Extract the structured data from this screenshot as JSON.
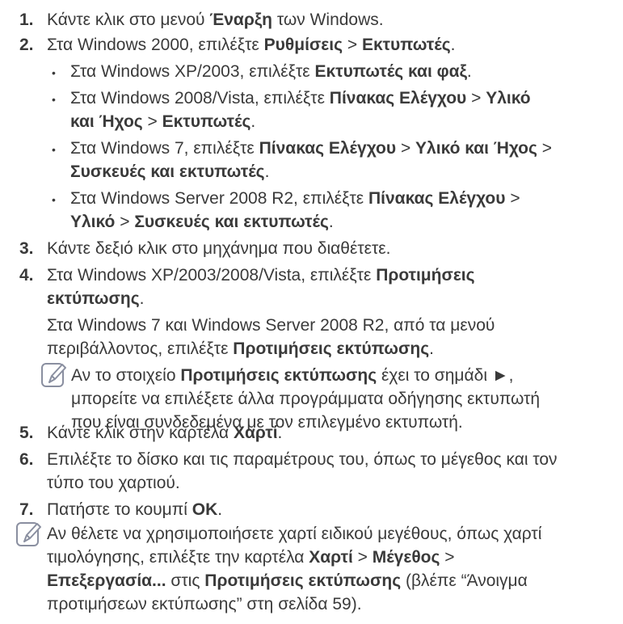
{
  "steps": [
    {
      "num": "1.",
      "text": [
        "Κάντε κλικ στο μενού ",
        {
          "b": "Έναρξη"
        },
        " των Windows."
      ]
    },
    {
      "num": "2.",
      "text": [
        "Στα Windows 2000, επιλέξτε ",
        {
          "b": "Ρυθμίσεις"
        },
        " > ",
        {
          "b": "Εκτυπωτές"
        },
        "."
      ]
    },
    {
      "bullet": "•",
      "text": [
        "Στα Windows XP/2003, επιλέξτε ",
        {
          "b": "Εκτυπωτές και φαξ"
        },
        "."
      ]
    },
    {
      "bullet": "•",
      "text": [
        "Στα Windows 2008/Vista, επιλέξτε ",
        {
          "b": "Πίνακας Ελέγχου"
        },
        " > ",
        {
          "b": "Υλικό"
        }
      ]
    },
    {
      "text": [
        {
          "b": "και Ήχος"
        },
        " > ",
        {
          "b": "Εκτυπωτές"
        },
        "."
      ]
    },
    {
      "bullet": "•",
      "text": [
        "Στα Windows 7, επιλέξτε ",
        {
          "b": "Πίνακας Ελέγχου"
        },
        " > ",
        {
          "b": "Υλικό και Ήχος"
        },
        " >"
      ]
    },
    {
      "text": [
        {
          "b": "Συσκευές και εκτυπωτές"
        },
        "."
      ]
    },
    {
      "bullet": "•",
      "text": [
        "Στα Windows Server 2008 R2, επιλέξτε ",
        {
          "b": "Πίνακας Ελέγχου"
        },
        " >"
      ]
    },
    {
      "text": [
        {
          "b": "Υλικό"
        },
        " > ",
        {
          "b": "Συσκευές και εκτυπωτές"
        },
        "."
      ]
    },
    {
      "num": "3.",
      "text": [
        "Κάντε δεξιό κλικ στο μηχάνημα που διαθέτετε."
      ]
    },
    {
      "num": "4.",
      "text": [
        "Στα Windows XP/2003/2008/Vista, επιλέξτε ",
        {
          "b": "Προτιμήσεις"
        }
      ]
    },
    {
      "text": [
        {
          "b": "εκτύπωσης"
        },
        "."
      ]
    },
    {
      "text": [
        "Στα Windows 7 και Windows Server 2008 R2, από τα μενού"
      ]
    },
    {
      "text": [
        "περιβάλλοντος, επιλέξτε ",
        {
          "b": "Προτιμήσεις εκτύπωσης"
        },
        "."
      ]
    },
    {
      "text": [
        "Αν το στοιχείο ",
        {
          "b": "Προτιμήσεις εκτύπωσης"
        },
        " έχει το σημάδι ►,"
      ]
    },
    {
      "text": [
        "μπορείτε να επιλέξετε άλλα προγράμματα οδήγησης εκτυπωτή"
      ]
    },
    {
      "text": [
        "που είναι συνδεδεμένα με τον επιλεγμένο εκτυπωτή."
      ]
    },
    {
      "num": "5.",
      "text": [
        "Κάντε κλικ στην καρτέλα ",
        {
          "b": "Χαρτί"
        },
        "."
      ]
    },
    {
      "num": "6.",
      "text": [
        "Επιλέξτε το δίσκο και τις παραμέτρους του, όπως το μέγεθος και τον"
      ]
    },
    {
      "text": [
        "τύπο του χαρτιού."
      ]
    },
    {
      "num": "7.",
      "text": [
        "Πατήστε το κουμπί ",
        {
          "b": "OK"
        },
        "."
      ]
    },
    {
      "text": [
        "Αν θέλετε να χρησιμοποιήσετε χαρτί ειδικού μεγέθους, όπως χαρτί"
      ]
    },
    {
      "text": [
        "τιμολόγησης, επιλέξτε την καρτέλα ",
        {
          "b": "Χαρτί"
        },
        " > ",
        {
          "b": "Μέγεθος"
        },
        " >"
      ]
    },
    {
      "text": [
        {
          "b": "Επεξεργασία..."
        },
        " στις ",
        {
          "b": "Προτιμήσεις εκτύπωσης"
        },
        " (βλέπε “Άνοιγμα"
      ]
    },
    {
      "text": [
        "προτιμήσεων εκτύπωσης” στη σελίδα 59)."
      ]
    }
  ]
}
